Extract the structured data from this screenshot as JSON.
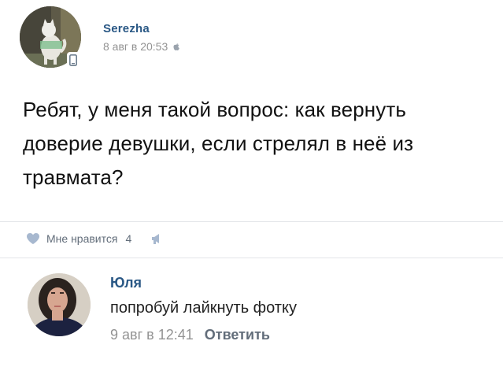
{
  "post": {
    "author": {
      "name": "Serezha",
      "avatar_icon": "cat-photo-avatar",
      "device_icon": "mobile-phone-icon"
    },
    "meta": {
      "date_time": "8 авг в 20:53",
      "platform_icon": "apple-icon"
    },
    "text": "Ребят, у меня такой вопрос: как вернуть доверие девушки, если стрелял в неё из травмата?",
    "actions": {
      "like_icon": "heart-icon",
      "like_label": "Мне нравится",
      "like_count": "4",
      "share_icon": "megaphone-icon"
    }
  },
  "comment": {
    "author": "Юля",
    "avatar_icon": "woman-photo-avatar",
    "text": "попробуй лайкнуть фотку",
    "date_time": "9 авг в 12:41",
    "reply_label": "Ответить"
  },
  "colors": {
    "link_blue": "#2a5885",
    "meta_gray": "#939393",
    "action_gray": "#626d7a",
    "divider": "#e3e5e8",
    "heart_blue": "#a7b8cf"
  }
}
